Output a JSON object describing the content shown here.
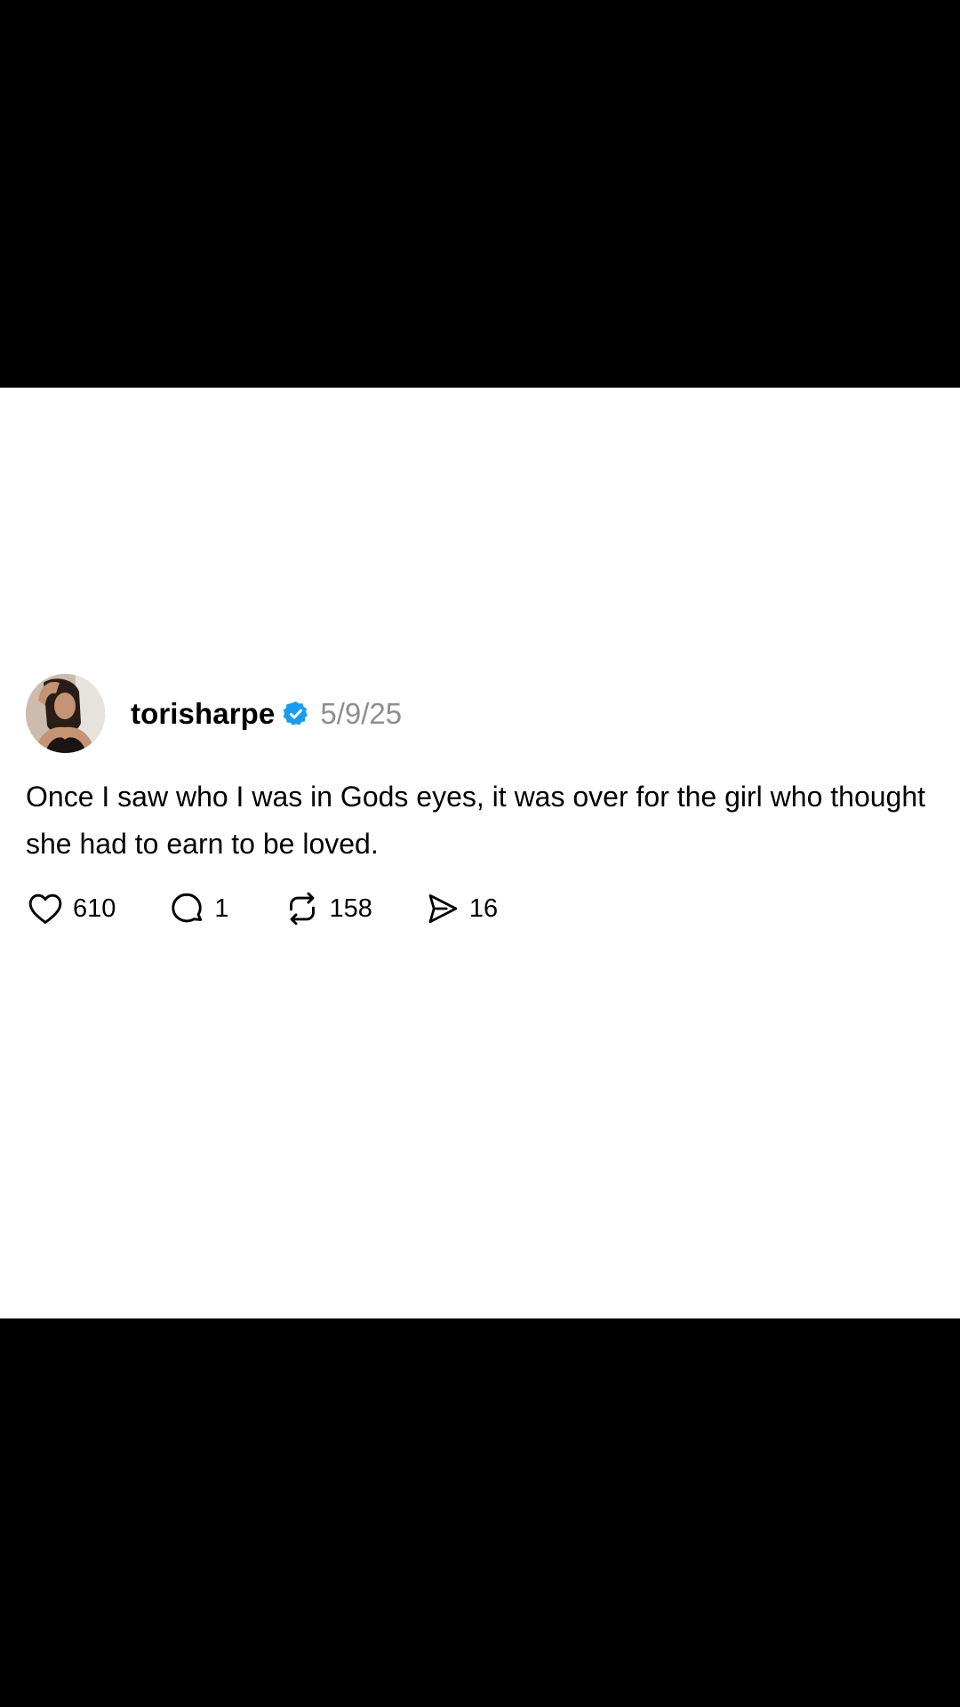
{
  "post": {
    "username": "torisharpe",
    "verified": true,
    "date": "5/9/25",
    "text": "Once I saw who I was in Gods eyes, it was over for the girl who thought she had to earn to be loved.",
    "accent_color": "#1d9bf0",
    "avatar_icon": "profile-photo"
  },
  "actions": {
    "likes": {
      "icon": "heart-icon",
      "count": "610"
    },
    "comments": {
      "icon": "comment-icon",
      "count": "1"
    },
    "reposts": {
      "icon": "repost-icon",
      "count": "158"
    },
    "shares": {
      "icon": "send-icon",
      "count": "16"
    }
  }
}
